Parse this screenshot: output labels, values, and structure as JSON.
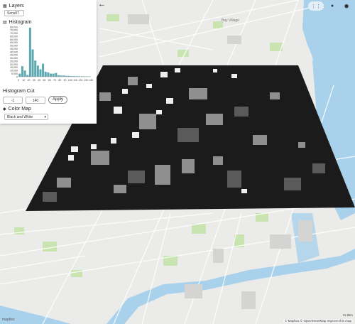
{
  "panel": {
    "layers_title": "Layers",
    "layer_value": "Sens07",
    "histogram_title": "Histogram",
    "histogram": {
      "y_ticks": [
        "80,000",
        "75,000",
        "70,000",
        "65,000",
        "60,000",
        "55,000",
        "50,000",
        "45,000",
        "40,000",
        "35,000",
        "30,000",
        "25,000",
        "20,000",
        "15,000",
        "10,000",
        "5,000",
        "0"
      ],
      "x_ticks": [
        "0",
        "10",
        "20",
        "30",
        "40",
        "50",
        "60",
        "70",
        "80",
        "90",
        "100",
        "110",
        "120",
        "130",
        "140"
      ],
      "bar_values": [
        5000,
        17000,
        10000,
        3000,
        79000,
        44000,
        26000,
        18000,
        12000,
        21000,
        8000,
        7000,
        5000,
        5000,
        6000,
        2500,
        2000,
        2000,
        1500,
        1500,
        1000,
        1000,
        900,
        800,
        700,
        600,
        500,
        400
      ],
      "y_max": 80000,
      "bar_color": "#5faab1"
    },
    "cut_title": "Histogram Cut",
    "cut_min": "-1",
    "cut_max": "140",
    "apply_label": "Apply",
    "colormap_title": "Color Map",
    "colormap_value": "Black and White"
  },
  "map": {
    "labels": {
      "bay": "Bay Village"
    },
    "mapbox_logo": "mapbox",
    "attribution": "© Mapbox © OpenStreetMap Improve this map",
    "scale": "11.8km",
    "colors": {
      "land": "#ebebea",
      "water": "#a9d1ec",
      "park": "#c9e4b0",
      "overlay": "#1b1b1b"
    }
  }
}
